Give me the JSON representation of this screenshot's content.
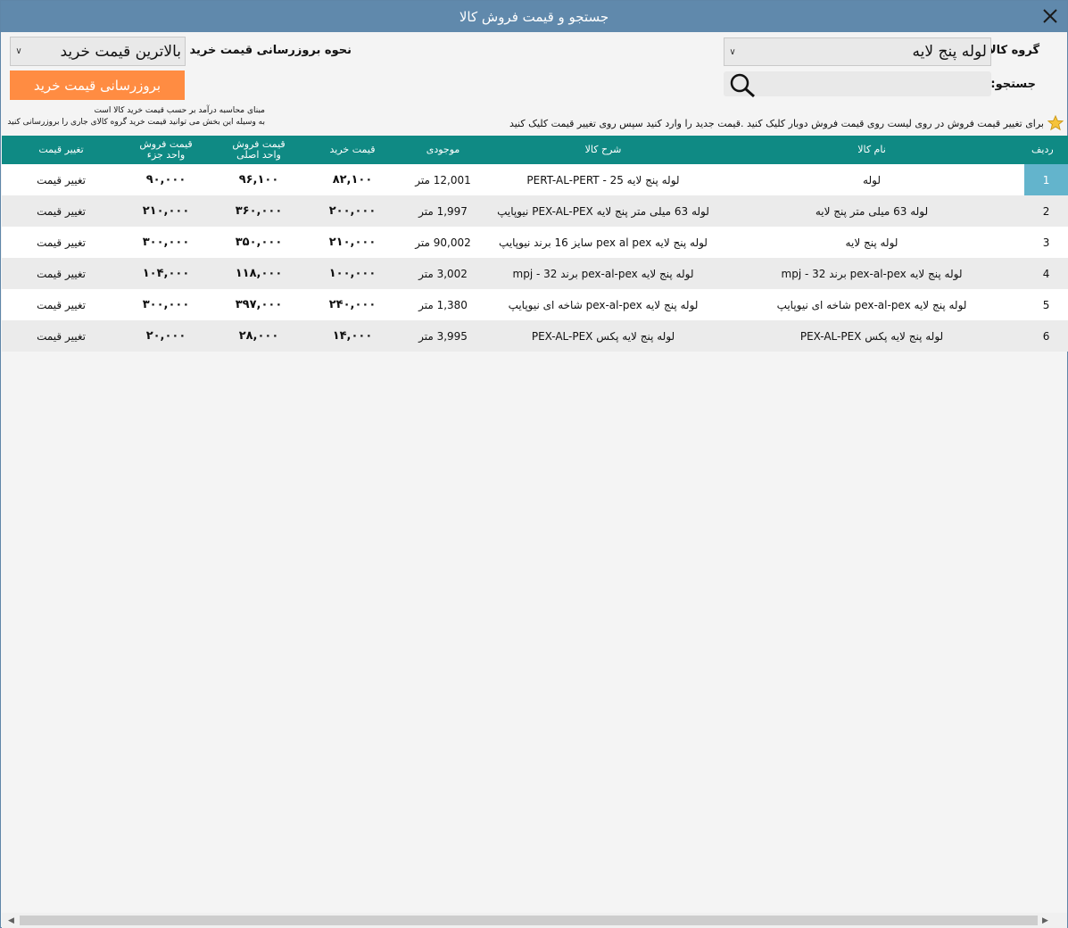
{
  "window": {
    "title": "جستجو و قیمت فروش کالا"
  },
  "group": {
    "label": "گروه کالا:",
    "value": "لوله پنج لایه"
  },
  "search": {
    "label": "جستجو:",
    "value": ""
  },
  "update_mode": {
    "label": "نحوه بروزرسانی قیمت خرید کالا :",
    "value": "بالاترین قیمت خرید"
  },
  "update_button": {
    "label": "بروزرسانی قیمت خرید"
  },
  "notes": {
    "line1": "مبنای محاسبه درآمد بر حسب قیمت خرید کالا است",
    "line2": "به وسیله این بخش می توانید قیمت خرید گروه کالای جاری را بروزرسانی کنید"
  },
  "hint": "برای تغییر قیمت فروش در روی لیست روی قیمت فروش دوبار کلیک کنید .قیمت جدید را وارد کنید سپس روی تغییر قیمت کلیک کنید",
  "table": {
    "headers": {
      "index": "ردیف",
      "name": "نام کالا",
      "desc": "شرح کالا",
      "stock": "موجودی",
      "buy": "قیمت خرید",
      "sell_main_1": "قیمت فروش",
      "sell_main_2": "واحد اصلی",
      "sell_part_1": "قیمت فروش",
      "sell_part_2": "واحد جزء",
      "change": "تغییر قیمت"
    },
    "rows": [
      {
        "index": "1",
        "name": "لوله",
        "desc": "لوله پنج لایه PERT-AL-PERT - 25",
        "stock": "12,001 متر",
        "buy": "۸۲,۱۰۰",
        "sell_main": "۹۶,۱۰۰",
        "sell_part": "۹۰,۰۰۰",
        "change": "تغییر قیمت"
      },
      {
        "index": "2",
        "name": "لوله 63 میلی متر پنج لایه",
        "desc": "لوله 63 میلی متر پنج لایه PEX-AL-PEX نیوپایپ",
        "stock": "1,997 متر",
        "buy": "۲۰۰,۰۰۰",
        "sell_main": "۳۶۰,۰۰۰",
        "sell_part": "۲۱۰,۰۰۰",
        "change": "تغییر قیمت"
      },
      {
        "index": "3",
        "name": "لوله پنج لایه",
        "desc": "لوله پنج لایه pex al pex سایز 16 برند نیوپایپ",
        "stock": "90,002 متر",
        "buy": "۲۱۰,۰۰۰",
        "sell_main": "۳۵۰,۰۰۰",
        "sell_part": "۳۰۰,۰۰۰",
        "change": "تغییر قیمت"
      },
      {
        "index": "4",
        "name": "لوله پنج لایه pex-al-pex برند mpj - 32",
        "desc": "لوله پنج لایه pex-al-pex برند mpj - 32",
        "stock": "3,002 متر",
        "buy": "۱۰۰,۰۰۰",
        "sell_main": "۱۱۸,۰۰۰",
        "sell_part": "۱۰۴,۰۰۰",
        "change": "تغییر قیمت"
      },
      {
        "index": "5",
        "name": "لوله پنج لایه pex-al-pex شاخه ای نیوپایپ",
        "desc": "لوله پنج لایه pex-al-pex شاخه ای نیوپایپ",
        "stock": "1,380 متر",
        "buy": "۲۴۰,۰۰۰",
        "sell_main": "۳۹۷,۰۰۰",
        "sell_part": "۳۰۰,۰۰۰",
        "change": "تغییر قیمت"
      },
      {
        "index": "6",
        "name": "لوله پنج لایه پکس PEX-AL-PEX",
        "desc": "لوله پنج لایه پکس PEX-AL-PEX",
        "stock": "3,995 متر",
        "buy": "۱۴,۰۰۰",
        "sell_main": "۲۸,۰۰۰",
        "sell_part": "۲۰,۰۰۰",
        "change": "تغییر قیمت"
      }
    ],
    "selected_index": 0
  },
  "colors": {
    "titlebar": "#6089ac",
    "header": "#0f8a84",
    "button": "#ff8c42",
    "selected": "#63b4cc"
  }
}
